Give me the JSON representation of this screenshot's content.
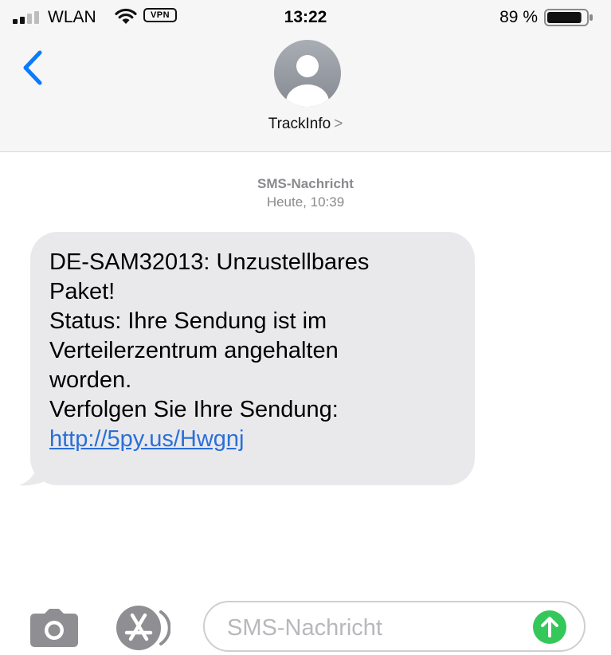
{
  "status_bar": {
    "carrier": "WLAN",
    "vpn": "VPN",
    "time": "13:22",
    "battery_percent": "89 %",
    "battery_level": 0.89,
    "icons": [
      "signal-bars-icon",
      "wifi-icon",
      "vpn-badge",
      "battery-icon"
    ]
  },
  "header": {
    "back_icon": "chevron-left-icon",
    "avatar_icon": "person-silhouette-icon",
    "contact_name": "TrackInfo",
    "contact_chevron": ">"
  },
  "conversation": {
    "message_kind": "SMS-Nachricht",
    "timestamp": "Heute, 10:39",
    "messages": [
      {
        "direction": "incoming",
        "lines": [
          "DE-SAM32013: Unzustellbares",
          "Paket!",
          "Status: Ihre Sendung ist im",
          "Verteilerzentrum angehalten",
          "worden.",
          "Verfolgen Sie Ihre Sendung:"
        ],
        "link": "http://5py.us/Hwgnj"
      }
    ]
  },
  "composer": {
    "camera_icon": "camera-icon",
    "appstore_icon": "app-store-icon",
    "placeholder": "SMS-Nachricht",
    "send_icon": "send-arrow-icon"
  },
  "colors": {
    "accent_blue": "#0a7aff",
    "link_blue": "#2a6fd8",
    "bubble_gray": "#e9e9eb",
    "send_green": "#34c759",
    "header_bg": "#f6f6f6",
    "meta_gray": "#8a8a8e"
  }
}
